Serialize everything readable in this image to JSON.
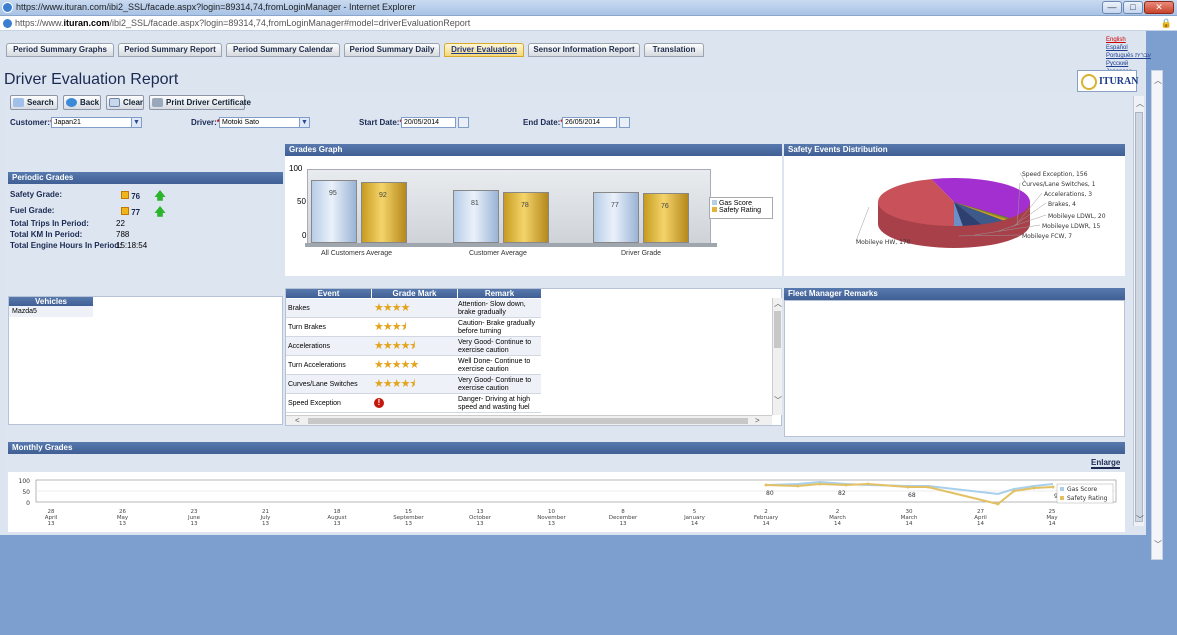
{
  "window": {
    "title": "https://www.ituran.com/ibi2_SSL/facade.aspx?login=89314,74,fromLoginManager - Internet Explorer",
    "url_prefix": "https://www.",
    "url_host": "ituran.com",
    "url_path": "/ibi2_SSL/facade.aspx?login=89314,74,fromLoginManager#model=driverEvaluationReport",
    "btn_min": "—",
    "btn_max": "□",
    "btn_close": "✕"
  },
  "tabs": [
    {
      "label": "Period Summary Graphs"
    },
    {
      "label": "Period Summary Report"
    },
    {
      "label": "Period Summary Calendar"
    },
    {
      "label": "Period Summary Daily"
    },
    {
      "label": "Driver Evaluation"
    },
    {
      "label": "Sensor Information Report"
    },
    {
      "label": "Translation"
    }
  ],
  "languages": [
    "English",
    "Español",
    "Português",
    "עברית",
    "Русский",
    "Japanese"
  ],
  "page_title": "Driver Evaluation Report",
  "logo_text": "ITURAN",
  "toolbar": {
    "search": "Search",
    "back": "Back",
    "clear": "Clear",
    "print": "Print Driver Certificate"
  },
  "filters": {
    "customer_label": "Customer:",
    "customer_value": "Japan21",
    "driver_label": "Driver:",
    "driver_value": "Motoki Sato",
    "start_label": "Start Date:",
    "start_value": "20/05/2014",
    "end_label": "End Date:",
    "end_value": "26/05/2014",
    "required_mark": "*"
  },
  "periodic": {
    "header": "Periodic Grades",
    "safety_label": "Safety Grade:",
    "safety_value": "76",
    "fuel_label": "Fuel Grade:",
    "fuel_value": "77",
    "trips_label": "Total Trips In Period:",
    "trips_value": "22",
    "km_label": "Total KM In Period:",
    "km_value": "788",
    "hours_label": "Total Engine Hours In Period:",
    "hours_value": "15:18:54"
  },
  "vehicles": {
    "header": "Vehicles",
    "items": [
      "Mazda5"
    ]
  },
  "grades_graph": {
    "header": "Grades Graph",
    "y_ticks": [
      "100",
      "50",
      "0"
    ],
    "legend": [
      "Gas Score",
      "Safety Rating"
    ],
    "colors": {
      "gas": "#b7cde6",
      "safety": "#e3b33a"
    },
    "groups": [
      {
        "label": "All Customers Average",
        "gas": 95,
        "safety": 92
      },
      {
        "label": "Customer Average",
        "gas": 81,
        "safety": 78
      },
      {
        "label": "Driver Grade",
        "gas": 77,
        "safety": 76
      }
    ]
  },
  "safety_dist": {
    "header": "Safety Events Distribution",
    "slices": [
      {
        "label": "Speed Exception",
        "value": 156,
        "color": "#a42fd0"
      },
      {
        "label": "Curves/Lane Switches",
        "value": 1,
        "color": "#4c6e2a"
      },
      {
        "label": "Accelerations",
        "value": 3,
        "color": "#7a8b3a"
      },
      {
        "label": "Brakes",
        "value": 4,
        "color": "#c4a41d"
      },
      {
        "label": "Mobileye LDWL",
        "value": 20,
        "color": "#3d5a8a"
      },
      {
        "label": "Mobileye LDWR",
        "value": 15,
        "color": "#2e4070"
      },
      {
        "label": "Mobileye FCW",
        "value": 7,
        "color": "#6d8fc8"
      },
      {
        "label": "Mobileye HW",
        "value": 170,
        "color": "#c8515a"
      }
    ]
  },
  "events_table": {
    "headers": [
      "Event",
      "Grade Mark",
      "Remark"
    ],
    "rows": [
      {
        "event": "Brakes",
        "stars": "★★★★",
        "remark": "Attention- Slow down, brake gradually"
      },
      {
        "event": "Turn Brakes",
        "stars": "★★★⯨",
        "remark": "Caution- Brake gradually before turning"
      },
      {
        "event": "Accelerations",
        "stars": "★★★★⯨",
        "remark": "Very Good- Continue to exercise caution"
      },
      {
        "event": "Turn Accelerations",
        "stars": "★★★★★",
        "remark": "Well Done- Continue to exercise caution"
      },
      {
        "event": "Curves/Lane Switches",
        "stars": "★★★★⯨",
        "remark": "Very Good- Continue to exercise caution"
      },
      {
        "event": "Speed Exception",
        "stars": "!",
        "remark": "Danger- Driving at high speed and wasting fuel"
      }
    ]
  },
  "fleet_remarks": {
    "header": "Fleet Manager Remarks"
  },
  "monthly": {
    "header": "Monthly Grades",
    "enlarge": "Enlarge",
    "y_ticks": [
      "100",
      "50",
      "0"
    ],
    "legend": [
      "Gas Score",
      "Safety Rating"
    ],
    "x_labels": [
      [
        "28",
        "April",
        "13"
      ],
      [
        "26",
        "May",
        "13"
      ],
      [
        "23",
        "June",
        "13"
      ],
      [
        "21",
        "July",
        "13"
      ],
      [
        "18",
        "August",
        "13"
      ],
      [
        "15",
        "September",
        "13"
      ],
      [
        "13",
        "October",
        "13"
      ],
      [
        "10",
        "November",
        "13"
      ],
      [
        "8",
        "December",
        "13"
      ],
      [
        "5",
        "January",
        "14"
      ],
      [
        "2",
        "February",
        "14"
      ],
      [
        "2",
        "March",
        "14"
      ],
      [
        "30",
        "March",
        "14"
      ],
      [
        "27",
        "April",
        "14"
      ],
      [
        "25",
        "May",
        "14"
      ]
    ],
    "point_labels": [
      "80",
      "82",
      "68",
      "90"
    ]
  }
}
